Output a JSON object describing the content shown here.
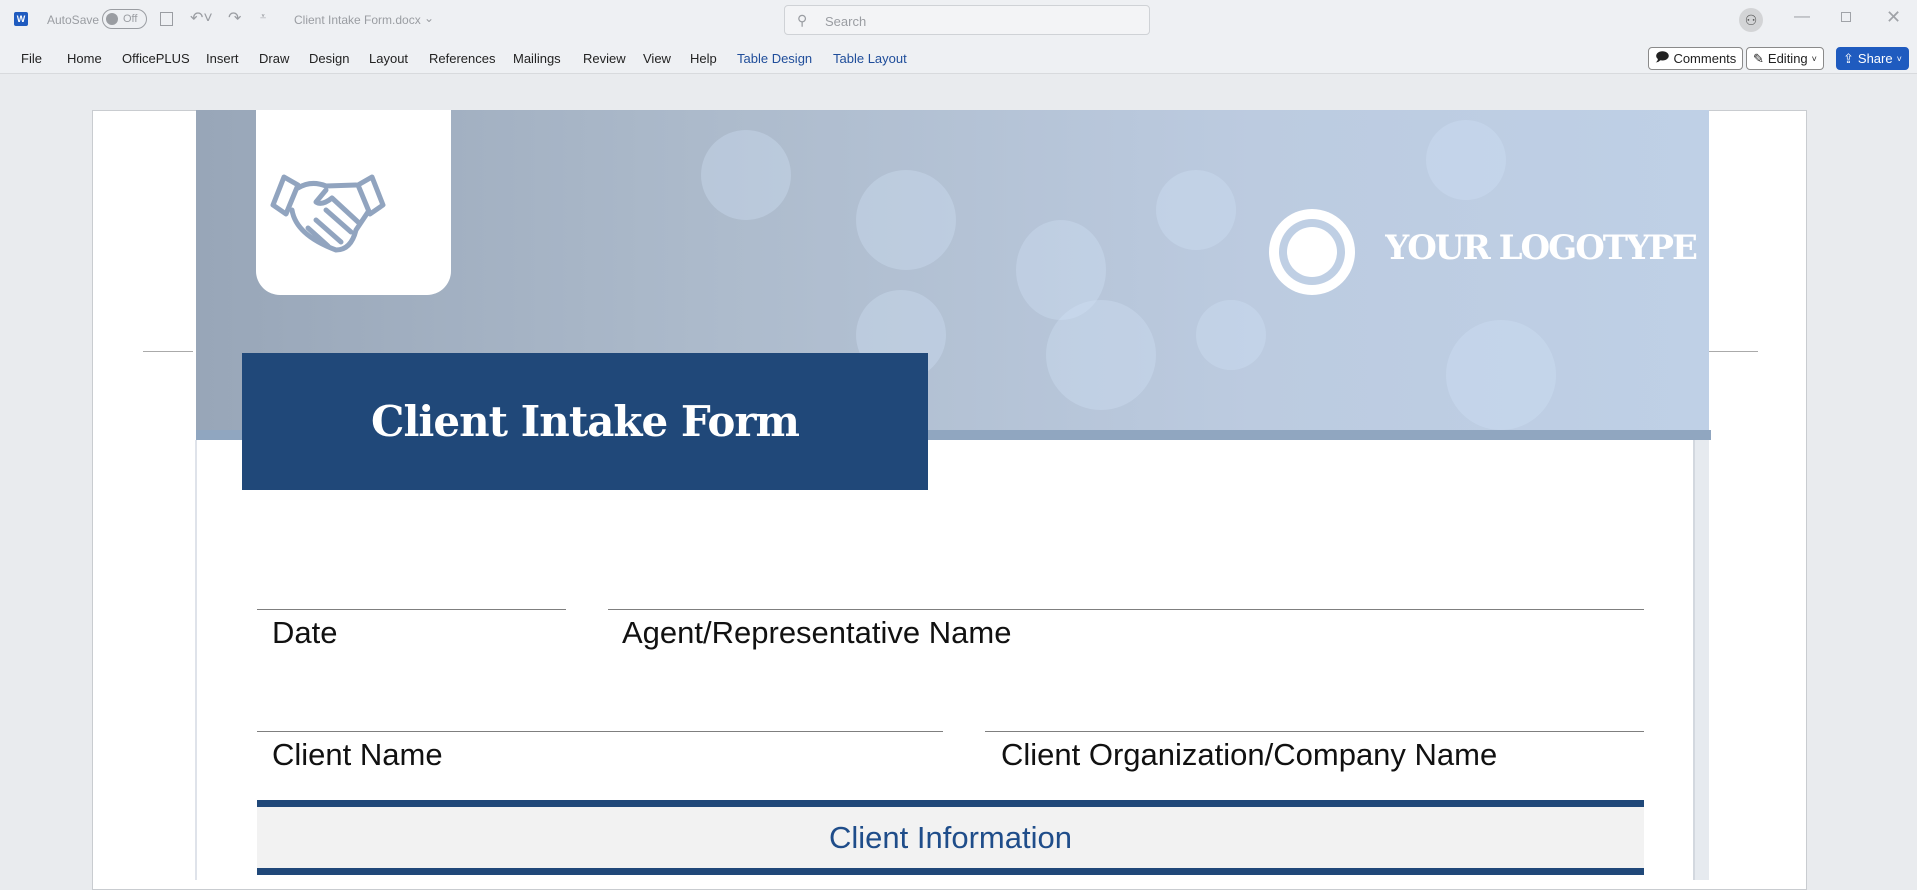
{
  "titlebar": {
    "autosave_label": "AutoSave",
    "autosave_state": "Off",
    "doc_title": "Client Intake Form.docx",
    "search_placeholder": "Search"
  },
  "ribbon": {
    "tabs": [
      "File",
      "Home",
      "OfficePLUS",
      "Insert",
      "Draw",
      "Design",
      "Layout",
      "References",
      "Mailings",
      "Review",
      "View",
      "Help",
      "Table Design",
      "Table Layout"
    ],
    "comments": "Comments",
    "editing": "Editing",
    "share": "Share"
  },
  "document": {
    "logotype": "YOUR LOGOTYPE",
    "title": "Client Intake Form",
    "fields": {
      "date": "Date",
      "agent": "Agent/Representative Name",
      "client_name": "Client Name",
      "client_org": "Client Organization/Company Name"
    },
    "section_heading": "Client Information"
  },
  "colors": {
    "accent": "#204879",
    "share": "#1f5bbf",
    "heading_text": "#1f4d8a"
  }
}
